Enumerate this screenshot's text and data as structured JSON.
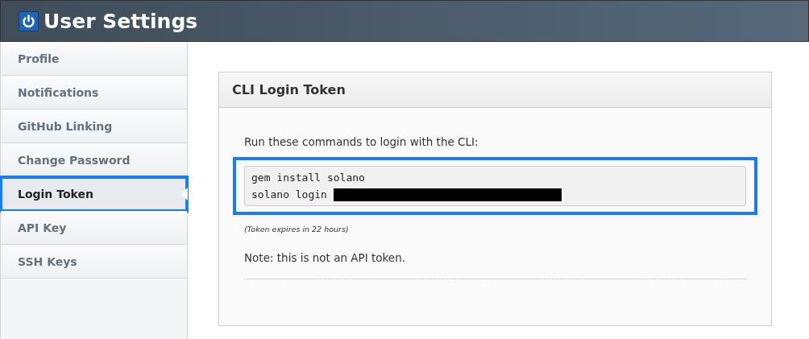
{
  "header": {
    "title": "User Settings"
  },
  "sidebar": {
    "items": [
      {
        "label": "Profile",
        "selected": false,
        "highlighted": false
      },
      {
        "label": "Notifications",
        "selected": false,
        "highlighted": false
      },
      {
        "label": "GitHub Linking",
        "selected": false,
        "highlighted": false
      },
      {
        "label": "Change Password",
        "selected": false,
        "highlighted": false
      },
      {
        "label": "Login Token",
        "selected": true,
        "highlighted": true
      },
      {
        "label": "API Key",
        "selected": false,
        "highlighted": false
      },
      {
        "label": "SSH Keys",
        "selected": false,
        "highlighted": false
      }
    ]
  },
  "panel": {
    "title": "CLI Login Token",
    "intro": "Run these commands to login with the CLI:",
    "code_block": {
      "highlighted": true,
      "lines": [
        {
          "text": "gem install solano",
          "redacted": false
        },
        {
          "text": "solano login",
          "redacted": true
        }
      ]
    },
    "expiry_note": "(Token expires in 22 hours)",
    "note": "Note: this is not an API token."
  }
}
